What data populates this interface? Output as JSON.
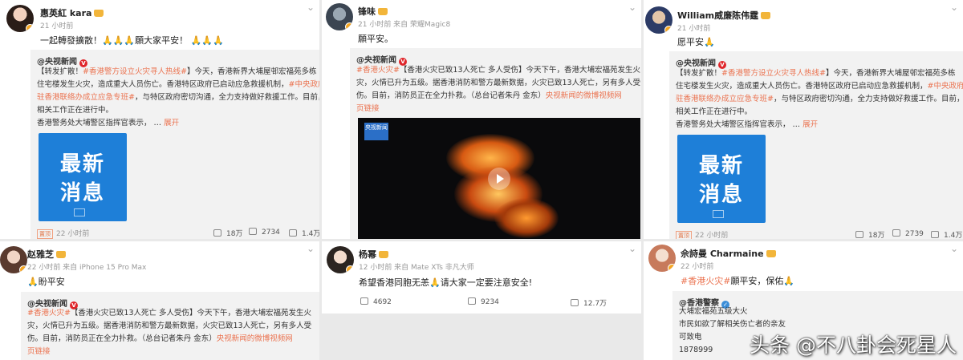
{
  "cards": {
    "c1": {
      "name": "惠英紅 kara",
      "time": "21 小时前",
      "text": "一起轉發擴散！🙏🙏🙏願大家平安！ 🙏🙏🙏",
      "source": "@央视新闻",
      "repost_lines": [
        [
          "【转发扩散！",
          "#香港警方设立火灾寻人热线#",
          "】今天，香港新界大埔屋邨宏福苑多栋"
        ],
        [
          "住宅楼发生火灾，造成重大人员伤亡。香港特区政府已启动应急救援机制，",
          "#中央政府"
        ],
        [
          "驻香港联络办成立应急专班#",
          "，与特区政府密切沟通，全力支持做好救援工作。目前，"
        ],
        [
          "相关工作正在进行中。"
        ],
        [
          "香港警务处大埔警区指挥官表示，   …",
          "展开"
        ]
      ],
      "card_title": "最新消息",
      "time2": "22 小时前",
      "ad": "置顶",
      "stats": [
        "18万",
        "2734",
        "1.4万"
      ]
    },
    "c2": {
      "name": "锋味",
      "time": "21 小时前 来自 荣耀Magic8",
      "text": "願平安。",
      "source": "@央视新闻",
      "repost_lines": [
        [
          "#香港火灾#",
          "【香港火灾已致13人死亡 多人受伤】今天下午，香港大埔宏福苑发生火"
        ],
        [
          "灾，火情已升为五级。据香港消防和警方最新数据，火灾已致13人死亡，另有多人受"
        ],
        [
          "伤。目前，消防员正在全力扑救。（总台记者朱丹 金东）",
          "央视新闻的微博视频",
          "网"
        ],
        [
          "页链接"
        ]
      ],
      "video_label": "央视新闻"
    },
    "c3": {
      "name": "William威廉陈伟霆",
      "time": "21 小时前",
      "text": "愿平安🙏",
      "source": "@央视新闻",
      "repost_lines": [
        [
          "【转发扩散！",
          "#香港警方设立火灾寻人热线#",
          "】今天，香港新界大埔屋邨宏福苑多栋"
        ],
        [
          "住宅楼发生火灾，造成重大人员伤亡。香港特区政府已启动应急救援机制，",
          "#中央政府"
        ],
        [
          "驻香港联络办成立应急专班#",
          "，与特区政府密切沟通，全力支持做好救援工作。目前，"
        ],
        [
          "相关工作正在进行中。"
        ],
        [
          "香港警务处大埔警区指挥官表示，   …",
          "展开"
        ]
      ],
      "card_title": "最新消息",
      "time2": "22 小时前",
      "ad": "置顶",
      "stats": [
        "18万",
        "2739",
        "1.4万"
      ]
    },
    "c4": {
      "name": "赵雅芝",
      "time": "22 小时前 来自 iPhone 15 Pro Max",
      "text": "🙏盼平安",
      "source": "@央视新闻",
      "repost_lines": [
        [
          "#香港火灾#",
          "【香港火灾已致13人死亡 多人受伤】今天下午，香港大埔宏福苑发生火"
        ],
        [
          "灾，火情已升为五级。据香港消防和警方最新数据，火灾已致13人死亡，另有多人受"
        ],
        [
          "伤。目前，消防员正在全力扑救。（总台记者朱丹 金东）",
          "央视新闻的微博视频",
          "网"
        ],
        [
          "页链接"
        ]
      ]
    },
    "c5": {
      "name": "杨幂",
      "time": "12 小时前 来自 Mate XTs 非凡大师",
      "text": "希望香港同胞无恙🙏请大家一定要注意安全!",
      "stats": [
        "4692",
        "9234",
        "12.7万"
      ]
    },
    "c6": {
      "name": "佘詩曼 Charmaine",
      "time": "22 小时前",
      "text_tag": "#香港火灾#",
      "text": "願平安，保佑🙏",
      "source": "@香港警察",
      "repost_lines": [
        [
          "大埔宏福苑五级大火"
        ],
        [
          "市民如欲了解相关伤亡者的亲友"
        ],
        [
          "可致电"
        ],
        [
          "1878999"
        ]
      ]
    }
  },
  "watermark": "头条 @不八卦会死星人",
  "colors": {
    "accent": "#eb7350",
    "bg": "#e9e9e9",
    "news_blue": "#1e7fd8"
  }
}
